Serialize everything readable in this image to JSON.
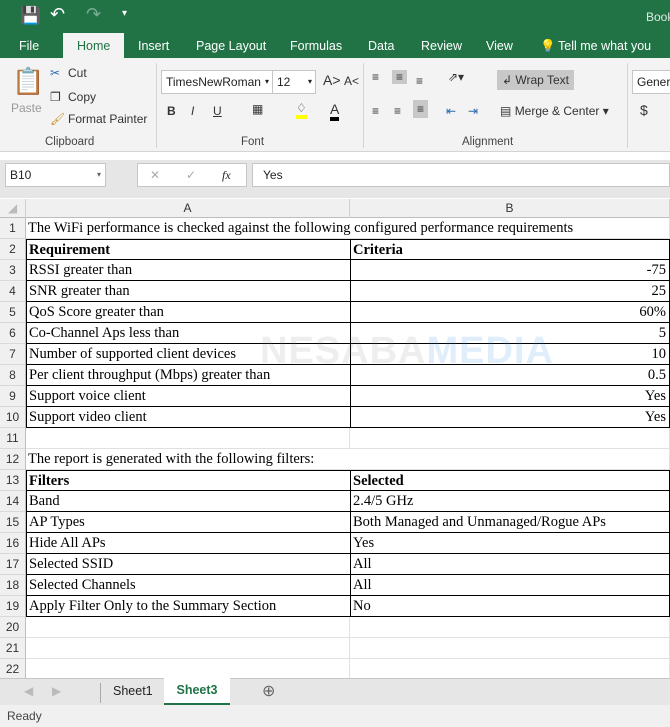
{
  "window": {
    "title": "Book"
  },
  "quick_access": {
    "save_icon": "save-icon",
    "undo_icon": "undo-icon",
    "redo_icon": "redo-icon",
    "customize_icon": "chevron-down-icon"
  },
  "ribbon_tabs": [
    "File",
    "Home",
    "Insert",
    "Page Layout",
    "Formulas",
    "Data",
    "Review",
    "View"
  ],
  "tell_me": "Tell me what you want",
  "active_tab": "Home",
  "clipboard": {
    "paste": "Paste",
    "cut": "Cut",
    "copy": "Copy",
    "format_painter": "Format Painter",
    "group": "Clipboard"
  },
  "font": {
    "name": "TimesNewRoman",
    "size": "12",
    "bold": "B",
    "italic": "I",
    "underline": "U",
    "font_color_letter": "A",
    "group": "Font",
    "highlight_color": "#ffff00",
    "font_color": "#000000"
  },
  "alignment": {
    "wrap_text": "Wrap Text",
    "merge_center": "Merge & Center",
    "group": "Alignment"
  },
  "number": {
    "format": "General",
    "currency": "$"
  },
  "formula_bar": {
    "name_box": "B10",
    "fx": "fx",
    "value": "Yes"
  },
  "columns": [
    "A",
    "B"
  ],
  "rows": [
    {
      "n": "1",
      "a": "The WiFi performance is checked against the following configured performance requirements",
      "b": ""
    },
    {
      "n": "2",
      "a": "Requirement",
      "b": "Criteria"
    },
    {
      "n": "3",
      "a": "RSSI greater than",
      "b": "-75"
    },
    {
      "n": "4",
      "a": "SNR greater than",
      "b": "25"
    },
    {
      "n": "5",
      "a": "QoS Score greater than",
      "b": "60%"
    },
    {
      "n": "6",
      "a": "Co-Channel Aps less than",
      "b": "5"
    },
    {
      "n": "7",
      "a": "Number of supported client devices",
      "b": "10"
    },
    {
      "n": "8",
      "a": "Per client throughput (Mbps) greater than",
      "b": "0.5"
    },
    {
      "n": "9",
      "a": "Support voice client",
      "b": "Yes"
    },
    {
      "n": "10",
      "a": "Support video client",
      "b": "Yes"
    },
    {
      "n": "11",
      "a": "",
      "b": ""
    },
    {
      "n": "12",
      "a": "The report is generated with the following filters:",
      "b": ""
    },
    {
      "n": "13",
      "a": "Filters",
      "b": "Selected"
    },
    {
      "n": "14",
      "a": "Band",
      "b": "2.4/5 GHz"
    },
    {
      "n": "15",
      "a": "AP Types",
      "b": "Both Managed and Unmanaged/Rogue APs"
    },
    {
      "n": "16",
      "a": "Hide All APs",
      "b": "Yes"
    },
    {
      "n": "17",
      "a": "Selected SSID",
      "b": "All"
    },
    {
      "n": "18",
      "a": "Selected Channels",
      "b": "All"
    },
    {
      "n": "19",
      "a": "Apply Filter Only to the Summary Section",
      "b": "No"
    },
    {
      "n": "20",
      "a": "",
      "b": ""
    },
    {
      "n": "21",
      "a": "",
      "b": ""
    },
    {
      "n": "22",
      "a": "",
      "b": ""
    }
  ],
  "watermark": "NESABAMEDIA",
  "sheets": [
    "Sheet1",
    "Sheet3"
  ],
  "active_sheet": "Sheet3",
  "status": "Ready",
  "colors": {
    "accent": "#217346"
  }
}
